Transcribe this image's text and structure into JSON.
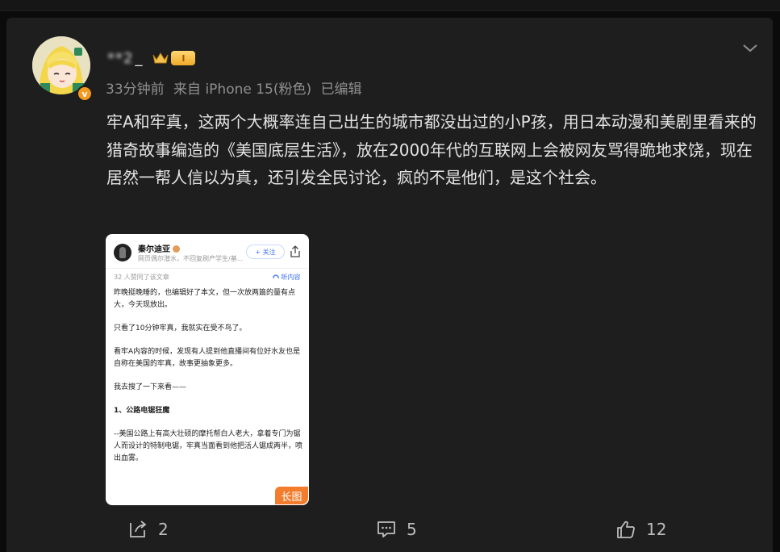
{
  "post": {
    "author": {
      "name_blurred": "**2",
      "name_tail": "_",
      "level": "I",
      "verified_badge": "v"
    },
    "meta": {
      "time": "33分钟前",
      "source": "来自 iPhone 15(粉色)",
      "edited": "已编辑"
    },
    "text": "牢A和牢真，这两个大概率连自己出生的城市都没出过的小P孩，用日本动漫和美剧里看来的猎奇故事编造的《美国底层生活》，放在2000年代的互联网上会被网友骂得跪地求饶，现在居然一帮人信以为真，还引发全民讨论，疯的不是他们，是这个社会。",
    "image": {
      "author_name": "秦尔迪亚",
      "author_bio": "网页偶尔潜水，不回复刷产学生/基...",
      "follow_label": "+ 关注",
      "liked_text": "32 人赞同了该文章",
      "listen_label": "听内容",
      "paragraphs": [
        "昨晚挺晚睡的，也编辑好了本文，但一次放两篇的量有点大，今天现放出。",
        "只看了10分钟牢真，我就实在受不鸟了。",
        "看牢A内容的时候，发现有人提到他直播间有位好水友也是自称在美国的牢真，故事更抽象更多。",
        "我去搜了一下来看——",
        "1、公路电锯狂魔",
        "--美国公路上有高大壮硕的摩托帮白人老大，拿着专门为锯人而设计的特制电锯，牢真当面看到他把活人锯成两半，喷出血雾。"
      ],
      "long_image_tag": "长图"
    },
    "actions": {
      "repost_count": "2",
      "comment_count": "5",
      "like_count": "12"
    }
  },
  "icons": {
    "menu": "chevron-down-icon",
    "repost": "repost-icon",
    "comment": "comment-icon",
    "like": "thumbs-up-icon",
    "share": "share-icon",
    "crown": "crown-icon",
    "headphones": "headphones-icon"
  },
  "colors": {
    "background": "#1e1e1e",
    "text": "#e3e3e3",
    "meta": "#8f8f8f",
    "verified": "#f49a1f",
    "long_tag": "#f2711c",
    "follow": "#3b6ff5"
  }
}
